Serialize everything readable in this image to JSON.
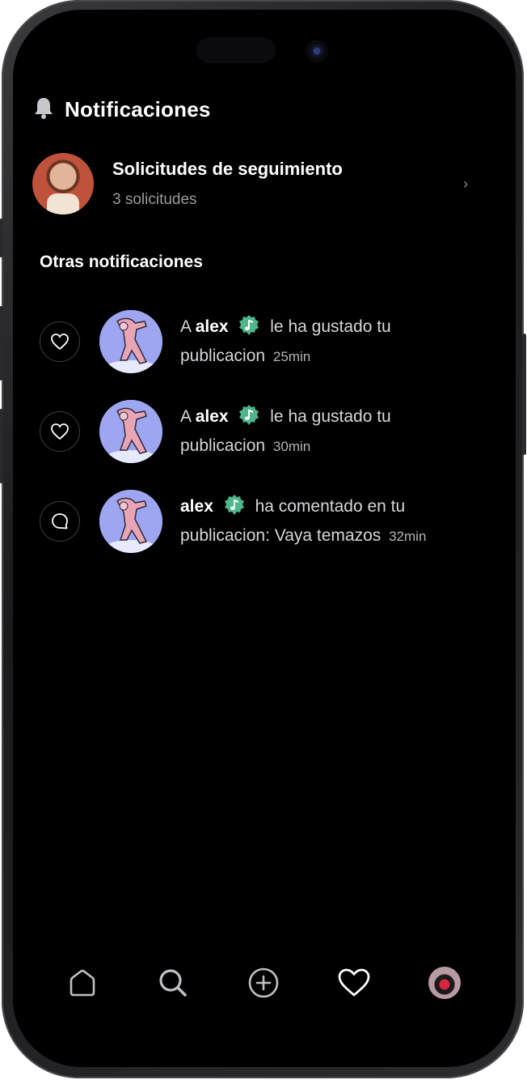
{
  "header": {
    "title": "Notificaciones",
    "icon": "bell-icon"
  },
  "follow_requests": {
    "title": "Solicitudes de seguimiento",
    "subtitle": "3 solicitudes",
    "chevron": "›"
  },
  "section_title": "Otras notificaciones",
  "notifications": [
    {
      "type": "like",
      "prefix": "A",
      "user": "alex",
      "action": "le ha gustado tu publicacion",
      "time": "25min"
    },
    {
      "type": "like",
      "prefix": "A",
      "user": "alex",
      "action": "le ha gustado tu publicacion",
      "time": "30min"
    },
    {
      "type": "comment",
      "prefix": "",
      "user": "alex",
      "action": "ha comentado en tu publicacion: Vaya temazos",
      "time": "32min"
    }
  ],
  "colors": {
    "background": "#000000",
    "verified": "#4db68a",
    "secondary_text": "#9a9a9e"
  },
  "bottom_nav": {
    "items": [
      "home-icon",
      "search-icon",
      "add-icon",
      "heart-icon",
      "profile-avatar"
    ],
    "active": "heart-icon"
  }
}
